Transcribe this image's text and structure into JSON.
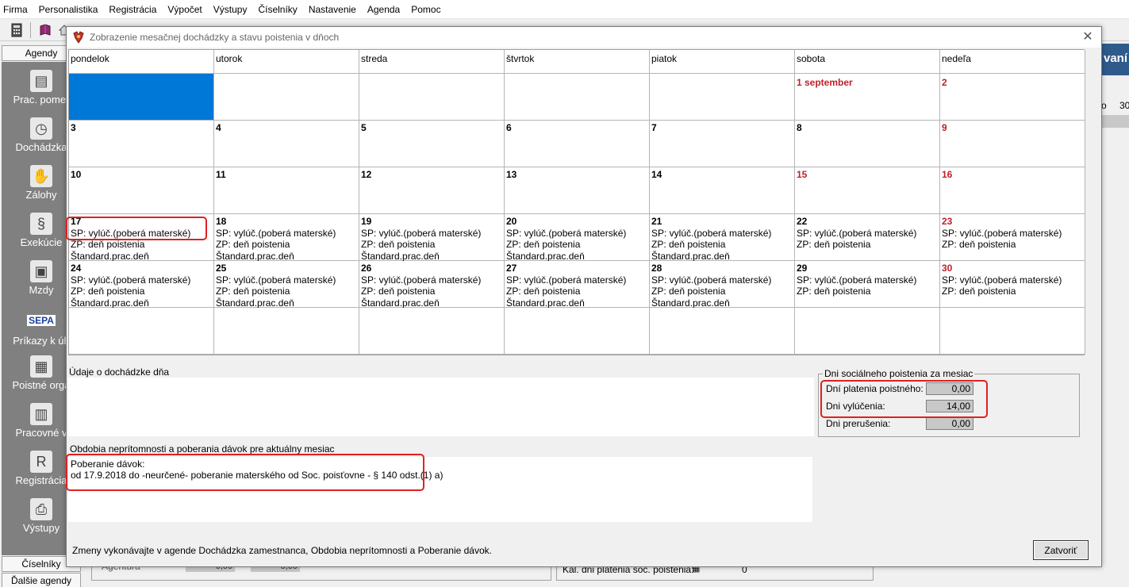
{
  "menubar": [
    "Firma",
    "Personalistika",
    "Registrácia",
    "Výpočet",
    "Výstupy",
    "Číselníky",
    "Nastavenie",
    "Agenda",
    "Pomoc"
  ],
  "sidebar": {
    "header": "Agendy",
    "items": [
      {
        "label": "Prac. pomer",
        "icon": "employee-icon"
      },
      {
        "label": "Dochádzka",
        "icon": "attendance-icon"
      },
      {
        "label": "Zálohy",
        "icon": "advances-icon"
      },
      {
        "label": "Exekúcie",
        "icon": "execution-icon"
      },
      {
        "label": "Mzdy",
        "icon": "wages-icon"
      },
      {
        "label": "Príkazy k úh",
        "icon": "sepa-icon",
        "badge": "SEPA"
      },
      {
        "label": "Poistné orga",
        "icon": "insurance-org-icon"
      },
      {
        "label": "Pracovné v",
        "icon": "work-icon"
      },
      {
        "label": "Registrácia",
        "icon": "registration-icon"
      },
      {
        "label": "Výstupy",
        "icon": "printer-icon"
      }
    ],
    "footer1": "Číselníky",
    "footer2": "Ďalšie agendy"
  },
  "background": {
    "right_header": "vaní",
    "right_label": "o",
    "right_value": "30",
    "bottom_left_label": "Agentúra",
    "bottom_left_val1": "0,00",
    "bottom_left_val2": "0,00",
    "bottom_right_label": "Kal. dni platenia soc. poistenia:",
    "bottom_right_value": "0"
  },
  "dialog": {
    "title": "Zobrazenie mesačnej dochádzky a stavu poistenia v dňoch",
    "close_glyph": "✕",
    "weekdays": [
      "pondelok",
      "utorok",
      "streda",
      "štvrtok",
      "piatok",
      "sobota",
      "nedeľa"
    ],
    "weeks": [
      [
        {
          "day": "",
          "selected": true,
          "lines": []
        },
        {
          "day": "",
          "lines": []
        },
        {
          "day": "",
          "lines": []
        },
        {
          "day": "",
          "lines": []
        },
        {
          "day": "",
          "lines": []
        },
        {
          "day": "1 september",
          "weekend": true,
          "lines": []
        },
        {
          "day": "2",
          "weekend": true,
          "lines": []
        }
      ],
      [
        {
          "day": "3",
          "lines": []
        },
        {
          "day": "4",
          "lines": []
        },
        {
          "day": "5",
          "lines": []
        },
        {
          "day": "6",
          "lines": []
        },
        {
          "day": "7",
          "lines": []
        },
        {
          "day": "8",
          "lines": []
        },
        {
          "day": "9",
          "weekend": true,
          "lines": []
        }
      ],
      [
        {
          "day": "10",
          "lines": []
        },
        {
          "day": "11",
          "lines": []
        },
        {
          "day": "12",
          "lines": []
        },
        {
          "day": "13",
          "lines": []
        },
        {
          "day": "14",
          "lines": []
        },
        {
          "day": "15",
          "weekend": true,
          "lines": []
        },
        {
          "day": "16",
          "weekend": true,
          "lines": []
        }
      ],
      [
        {
          "day": "17",
          "lines": [
            "SP: vylúč.(poberá materské)",
            "ZP: deň poistenia",
            "Štandard.prac.deň"
          ]
        },
        {
          "day": "18",
          "lines": [
            "SP: vylúč.(poberá materské)",
            "ZP: deň poistenia",
            "Štandard.prac.deň"
          ]
        },
        {
          "day": "19",
          "lines": [
            "SP: vylúč.(poberá materské)",
            "ZP: deň poistenia",
            "Štandard.prac.deň"
          ]
        },
        {
          "day": "20",
          "lines": [
            "SP: vylúč.(poberá materské)",
            "ZP: deň poistenia",
            "Štandard.prac.deň"
          ]
        },
        {
          "day": "21",
          "lines": [
            "SP: vylúč.(poberá materské)",
            "ZP: deň poistenia",
            "Štandard.prac.deň"
          ]
        },
        {
          "day": "22",
          "lines": [
            "SP: vylúč.(poberá materské)",
            "ZP: deň poistenia"
          ]
        },
        {
          "day": "23",
          "weekend": true,
          "lines": [
            "SP: vylúč.(poberá materské)",
            "ZP: deň poistenia"
          ]
        }
      ],
      [
        {
          "day": "24",
          "lines": [
            "SP: vylúč.(poberá materské)",
            "ZP: deň poistenia",
            "Štandard.prac.deň"
          ]
        },
        {
          "day": "25",
          "lines": [
            "SP: vylúč.(poberá materské)",
            "ZP: deň poistenia",
            "Štandard.prac.deň"
          ]
        },
        {
          "day": "26",
          "lines": [
            "SP: vylúč.(poberá materské)",
            "ZP: deň poistenia",
            "Štandard.prac.deň"
          ]
        },
        {
          "day": "27",
          "lines": [
            "SP: vylúč.(poberá materské)",
            "ZP: deň poistenia",
            "Štandard.prac.deň"
          ]
        },
        {
          "day": "28",
          "lines": [
            "SP: vylúč.(poberá materské)",
            "ZP: deň poistenia",
            "Štandard.prac.deň"
          ]
        },
        {
          "day": "29",
          "lines": [
            "SP: vylúč.(poberá materské)",
            "ZP: deň poistenia"
          ]
        },
        {
          "day": "30",
          "weekend": true,
          "lines": [
            "SP: vylúč.(poberá materské)",
            "ZP: deň poistenia"
          ]
        }
      ],
      [
        {
          "day": "",
          "lines": []
        },
        {
          "day": "",
          "lines": []
        },
        {
          "day": "",
          "lines": []
        },
        {
          "day": "",
          "lines": []
        },
        {
          "day": "",
          "lines": []
        },
        {
          "day": "",
          "lines": []
        },
        {
          "day": "",
          "lines": []
        }
      ]
    ],
    "attendance_label": "Údaje o dochádzke dňa",
    "insurance": {
      "title": "Dni sociálneho poistenia za mesiac",
      "rows": [
        {
          "label": "Dní platenia poistného:",
          "value": "0,00"
        },
        {
          "label": "Dni vylúčenia:",
          "value": "14,00"
        },
        {
          "label": "Dni prerušenia:",
          "value": "0,00"
        }
      ]
    },
    "absence_label": "Obdobia neprítomnosti a poberania dávok pre aktuálny mesiac",
    "absence_lines": [
      "Poberanie dávok:",
      "od 17.9.2018 do -neurčené- poberanie materského od Soc. poisťovne - § 140 odst.(1) a)"
    ],
    "footer_text": "Zmeny vykonávajte v agende Dochádzka zamestnanca, Obdobia neprítomnosti a Poberanie dávok.",
    "close_button": "Zatvoriť"
  },
  "colors": {
    "weekend": "#c0202a",
    "selection": "#0078d7",
    "highlight": "#e02020",
    "sidebar": "#808080"
  }
}
